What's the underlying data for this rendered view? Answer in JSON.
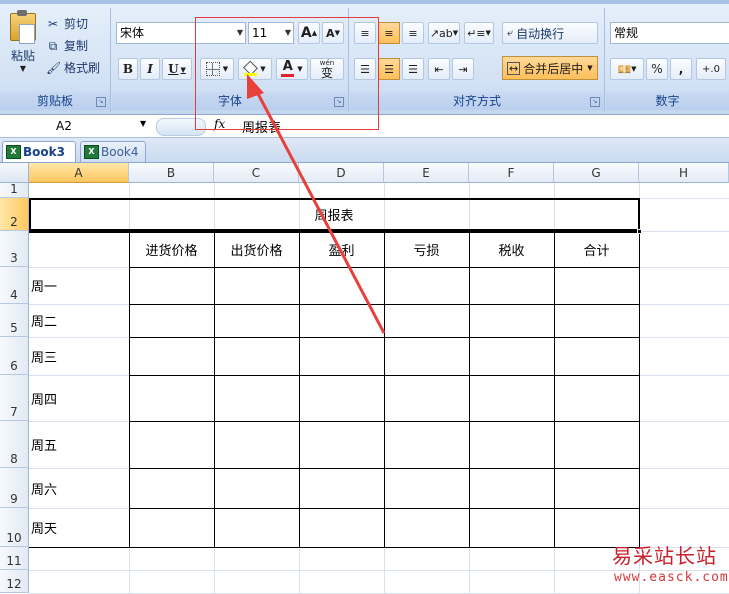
{
  "ribbon": {
    "clipboard": {
      "paste": "粘贴",
      "cut": "剪切",
      "copy": "复制",
      "format_painter": "格式刷",
      "group_label": "剪贴板"
    },
    "font": {
      "font_name": "宋体",
      "font_size": "11",
      "grow": "A",
      "shrink": "A",
      "bold": "B",
      "italic": "I",
      "underline": "U",
      "font_color_letter": "A",
      "phonetic": "wén",
      "phonetic_char": "变",
      "group_label": "字体"
    },
    "alignment": {
      "wrap_text": "自动换行",
      "merge_center": "合并后居中",
      "group_label": "对齐方式"
    },
    "number": {
      "format": "常规",
      "percent": "%",
      "comma": ",",
      "increase_decimal": "+.0",
      "group_label": "数字"
    }
  },
  "formula_bar": {
    "cell_ref": "A2",
    "fx": "fx",
    "content": "周报表"
  },
  "tabs": [
    {
      "label": "Book3 *",
      "active": true
    },
    {
      "label": "Book4",
      "active": false
    }
  ],
  "grid": {
    "columns": [
      "A",
      "B",
      "C",
      "D",
      "E",
      "F",
      "G",
      "H"
    ],
    "rows": [
      "1",
      "2",
      "3",
      "4",
      "5",
      "6",
      "7",
      "8",
      "9",
      "10",
      "11",
      "12"
    ],
    "title": "周报表",
    "headers": [
      "进货价格",
      "出货价格",
      "盈利",
      "亏损",
      "税收",
      "合计"
    ],
    "days": [
      "周一",
      "周二",
      "周三",
      "周四",
      "周五",
      "周六",
      "周天"
    ]
  },
  "watermark": {
    "cn": "易采站长站",
    "url": "www.easck.com"
  },
  "colors": {
    "accent_selected": "#ffc760",
    "annotation_red": "#e23c3c",
    "ribbon_label": "#15428b"
  }
}
